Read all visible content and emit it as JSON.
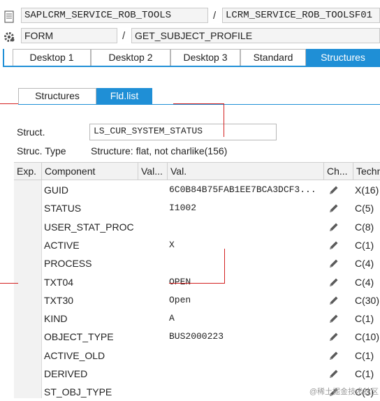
{
  "header": {
    "program": "SAPLCRM_SERVICE_ROB_TOOLS",
    "include": "LCRM_SERVICE_ROB_TOOLSF01",
    "type": "FORM",
    "routine": "GET_SUBJECT_PROFILE",
    "separator": "/"
  },
  "desktop_tabs": [
    "Desktop 1",
    "Desktop 2",
    "Desktop 3",
    "Standard",
    "Structures"
  ],
  "sub_tabs": [
    "Structures",
    "Fld.list"
  ],
  "struct": {
    "label": "Struct.",
    "value": "LS_CUR_SYSTEM_STATUS",
    "type_label": "Struc. Type",
    "type_value": "Structure: flat, not charlike(156)"
  },
  "table": {
    "columns": [
      "Exp.",
      "Component",
      "Val...",
      "Val.",
      "Ch...",
      "Techn"
    ],
    "rows": [
      {
        "component": "GUID",
        "val": "6C0B84B75FAB1EE7BCA3DCF3...",
        "tech": "X(16)"
      },
      {
        "component": "STATUS",
        "val": "I1002",
        "tech": "C(5)"
      },
      {
        "component": "USER_STAT_PROC",
        "val": "",
        "tech": "C(8)"
      },
      {
        "component": "ACTIVE",
        "val": "X",
        "tech": "C(1)"
      },
      {
        "component": "PROCESS",
        "val": "",
        "tech": "C(4)"
      },
      {
        "component": "TXT04",
        "val": "OPEN",
        "tech": "C(4)"
      },
      {
        "component": "TXT30",
        "val": "Open",
        "tech": "C(30)"
      },
      {
        "component": "KIND",
        "val": "A",
        "tech": "C(1)"
      },
      {
        "component": "OBJECT_TYPE",
        "val": "BUS2000223",
        "tech": "C(10)"
      },
      {
        "component": "ACTIVE_OLD",
        "val": "",
        "tech": "C(1)"
      },
      {
        "component": "DERIVED",
        "val": "",
        "tech": "C(1)"
      },
      {
        "component": "ST_OBJ_TYPE",
        "val": "",
        "tech": "C(3)"
      }
    ]
  },
  "watermark": "@稀土掘金技术社区",
  "colors": {
    "accent": "#1f8fd6",
    "annotation": "#d32020"
  }
}
